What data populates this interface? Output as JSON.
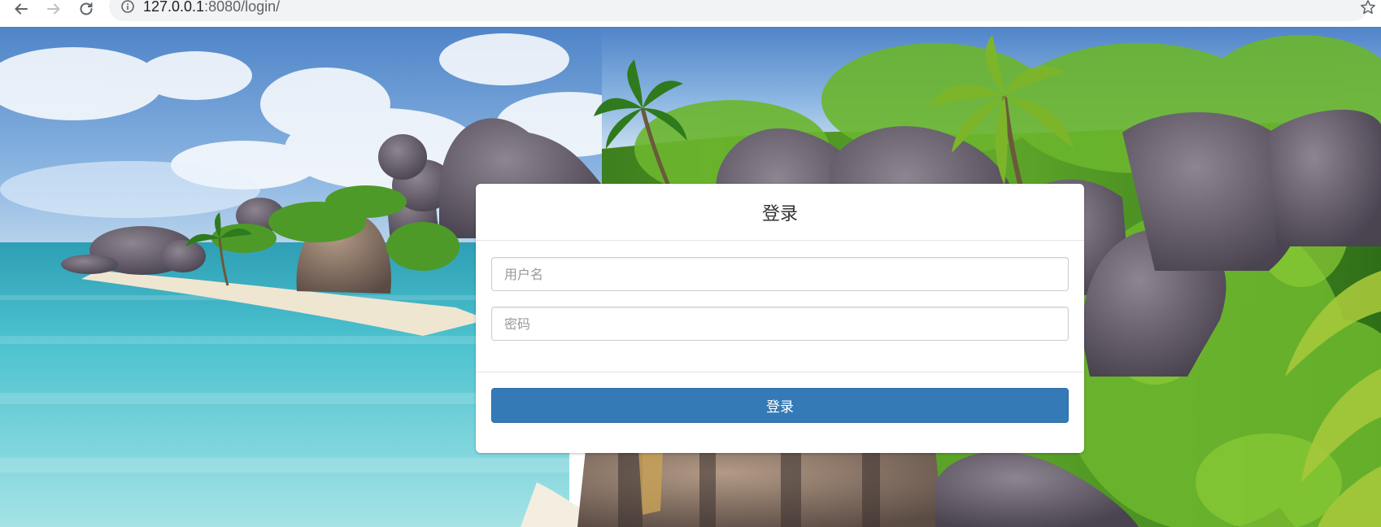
{
  "browser": {
    "url_host": "127.0.0.1",
    "url_rest": ":8080/login/",
    "icons": {
      "back": "arrow-left-icon",
      "forward": "arrow-right-icon",
      "reload": "reload-icon",
      "info": "info-icon",
      "bookmark": "star-icon"
    }
  },
  "login": {
    "title": "登录",
    "username_placeholder": "用户名",
    "password_placeholder": "密码",
    "submit_label": "登录"
  },
  "colors": {
    "primary_button": "#337ab7",
    "panel_bg": "#ffffff"
  }
}
